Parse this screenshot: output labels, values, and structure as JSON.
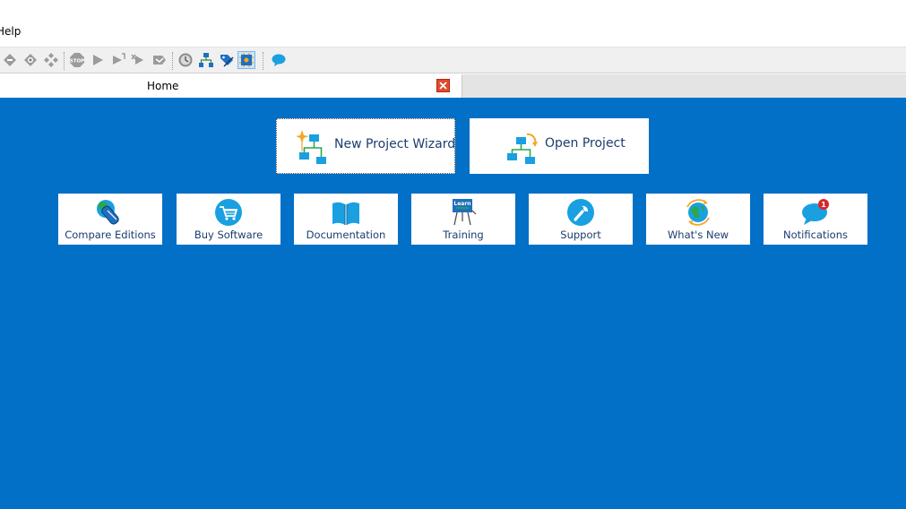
{
  "menu": {
    "help_label": "Help"
  },
  "toolbar": {
    "buttons": [
      "diamond-icon",
      "eye-diamond-icon",
      "dots-diamond-icon",
      "stop-icon",
      "play-icon",
      "step-icon",
      "step-over-icon",
      "fold-icon",
      "clock-icon",
      "hierarchy-icon",
      "tag-icon",
      "settings-chip-icon",
      "chat-icon"
    ],
    "active": "settings-chip-icon"
  },
  "tabs": [
    {
      "label": "Home",
      "active": true
    }
  ],
  "home": {
    "primary_cards": [
      {
        "label": "New Project Wizard",
        "icon": "new-project-wizard-icon"
      },
      {
        "label": "Open Project",
        "icon": "open-project-icon"
      }
    ],
    "resource_cards": [
      {
        "label": "Compare Editions",
        "icon": "compare-editions-icon"
      },
      {
        "label": "Buy Software",
        "icon": "shopping-cart-icon"
      },
      {
        "label": "Documentation",
        "icon": "book-icon"
      },
      {
        "label": "Training",
        "icon": "learn-board-icon",
        "icon_text": "Learn"
      },
      {
        "label": "Support",
        "icon": "wrench-icon"
      },
      {
        "label": "What's New",
        "icon": "globe-icon"
      },
      {
        "label": "Notifications",
        "icon": "chat-bubble-icon",
        "badge": "1"
      }
    ]
  },
  "colors": {
    "background": "#0170c6",
    "card": "#ffffff",
    "text": "#1b3d6e",
    "accent": "#1aa0e0"
  }
}
